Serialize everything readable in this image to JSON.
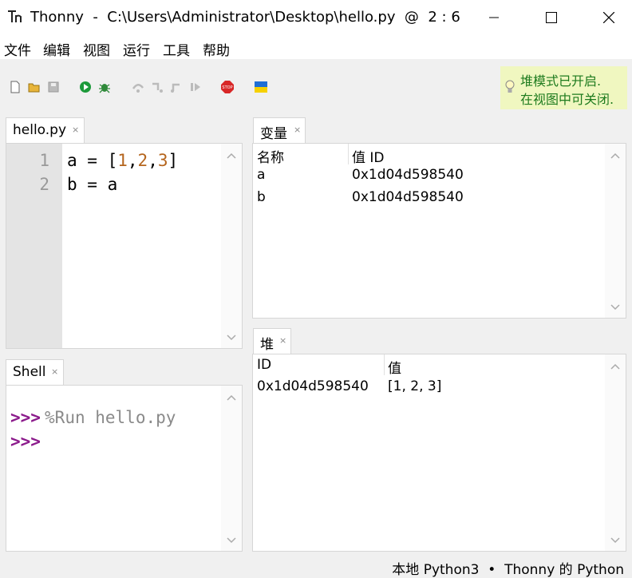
{
  "window": {
    "title": "Thonny  -  C:\\Users\\Administrator\\Desktop\\hello.py  @  2 : 6"
  },
  "menu": [
    "文件",
    "编辑",
    "视图",
    "运行",
    "工具",
    "帮助"
  ],
  "toolbar": {
    "buttons": [
      "new-file",
      "open-file",
      "save-file",
      "run",
      "debug",
      "step-over",
      "step-into",
      "step-out",
      "resume",
      "stop",
      "ukraine-flag"
    ]
  },
  "heap_tip": {
    "line1": "堆模式已开启.",
    "line2": "在视图中可关闭."
  },
  "editor": {
    "tab_label": "hello.py",
    "close_glyph": "×",
    "line_numbers": [
      "1",
      "2"
    ],
    "lines": [
      {
        "parts": [
          "a = [",
          "1",
          ",",
          "2",
          ",",
          "3",
          "]"
        ]
      },
      {
        "parts": [
          "b = a"
        ]
      }
    ]
  },
  "shell": {
    "tab_label": "Shell",
    "close_glyph": "×",
    "prompt": ">>>",
    "command": "%Run hello.py"
  },
  "variables": {
    "tab_label": "变量",
    "close_glyph": "×",
    "columns": [
      "名称",
      "值 ID"
    ],
    "rows": [
      {
        "name": "a",
        "id": "0x1d04d598540"
      },
      {
        "name": "b",
        "id": "0x1d04d598540"
      }
    ]
  },
  "heap": {
    "tab_label": "堆",
    "close_glyph": "×",
    "columns": [
      "ID",
      "值"
    ],
    "rows": [
      {
        "id": "0x1d04d598540",
        "value": "[1, 2, 3]"
      }
    ]
  },
  "status": {
    "interpreter": "本地 Python3  •  Thonny 的 Python"
  },
  "colors": {
    "number": "#b5651d",
    "prompt": "#8b1a8b",
    "tip_bg": "#f0f7c0",
    "tip_fg": "#1e7b1e"
  }
}
